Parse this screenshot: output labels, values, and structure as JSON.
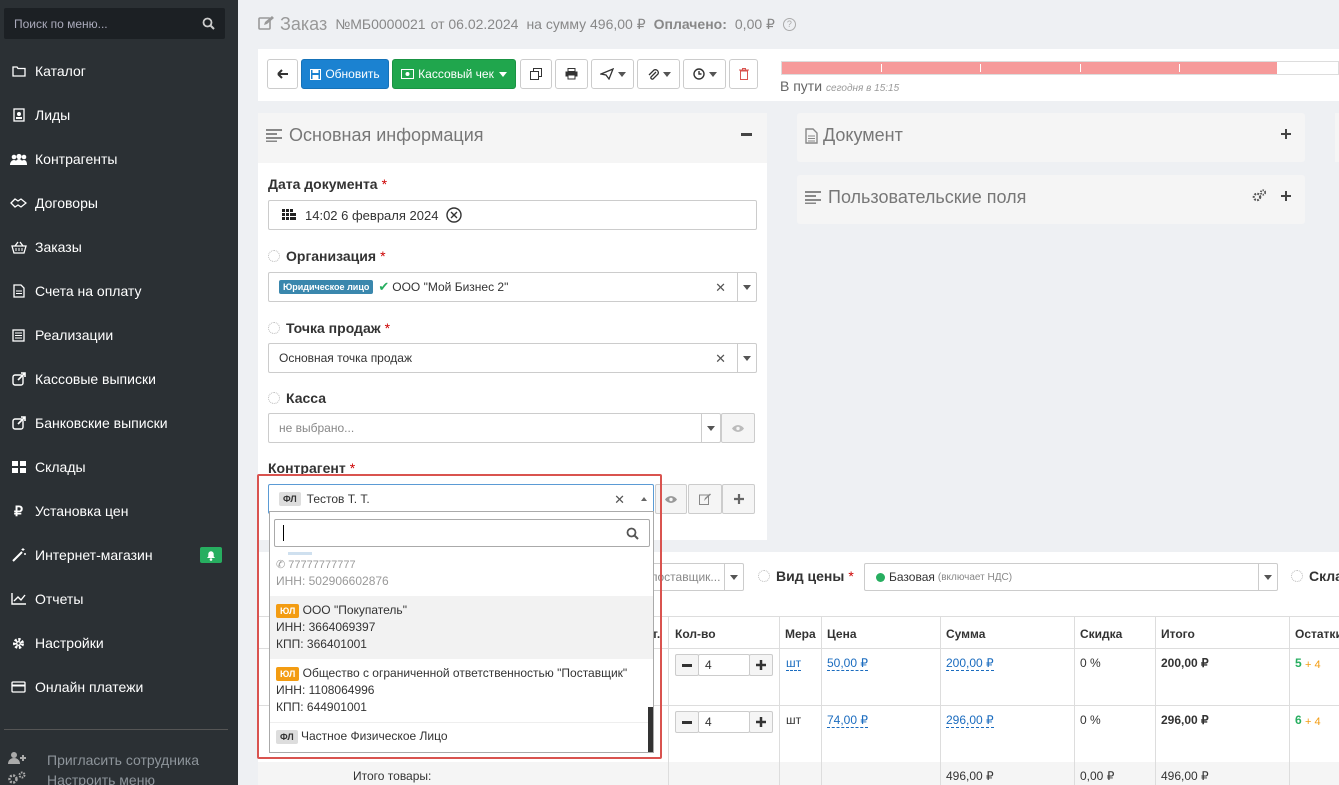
{
  "sidebar": {
    "search_placeholder": "Поиск по меню...",
    "items": [
      {
        "label": "Каталог",
        "icon": "folder-icon"
      },
      {
        "label": "Лиды",
        "icon": "contact-icon"
      },
      {
        "label": "Контрагенты",
        "icon": "users-icon"
      },
      {
        "label": "Договоры",
        "icon": "handshake-icon"
      },
      {
        "label": "Заказы",
        "icon": "basket-icon"
      },
      {
        "label": "Счета на оплату",
        "icon": "file-icon"
      },
      {
        "label": "Реализации",
        "icon": "list-icon"
      },
      {
        "label": "Кассовые выписки",
        "icon": "external-icon"
      },
      {
        "label": "Банковские выписки",
        "icon": "external-icon"
      },
      {
        "label": "Склады",
        "icon": "grid-icon"
      },
      {
        "label": "Установка цен",
        "icon": "ruble-icon"
      },
      {
        "label": "Интернет-магазин",
        "icon": "magic-icon"
      },
      {
        "label": "Отчеты",
        "icon": "chart-icon"
      },
      {
        "label": "Настройки",
        "icon": "gear-icon"
      },
      {
        "label": "Онлайн платежи",
        "icon": "card-icon"
      }
    ],
    "footer": [
      "Пригласить сотрудника",
      "Настроить меню"
    ]
  },
  "header": {
    "title": "Заказ",
    "number": "№МБ0000021",
    "date_text": "от 06.02.2024",
    "sum_text": "на сумму 496,00 ₽",
    "paid_label": "Оплачено:",
    "paid_value": "0,00 ₽"
  },
  "toolbar": {
    "refresh": "Обновить",
    "receipt": "Кассовый чек"
  },
  "status": {
    "label": "В пути",
    "time": "сегодня в 15:15",
    "progress": 0.89
  },
  "main_info": {
    "title": "Основная информация",
    "date_label": "Дата документа",
    "date_value": "14:02 6 февраля 2024",
    "org_label": "Организация",
    "org_badge": "Юридическое лицо",
    "org_value": "ООО \"Мой Бизнес 2\"",
    "point_label": "Точка продаж",
    "point_value": "Основная точка продаж",
    "kassa_label": "Касса",
    "kassa_placeholder": "не выбрано...",
    "contractor_label": "Контрагент",
    "contractor_badge": "ФЛ",
    "contractor_value": "Тестов Т. Т."
  },
  "doc_panel": {
    "title": "Документ"
  },
  "custom_panel": {
    "title": "Пользовательские поля"
  },
  "price": {
    "supplier_placeholder": "поставщик...",
    "label": "Вид цены",
    "value": "Базовая",
    "note": "(включает НДС)",
    "stock_label": "Скла"
  },
  "table": {
    "headers": {
      "qty": "Кол-во",
      "unit": "Мера",
      "price": "Цена",
      "sum": "Сумма",
      "discount": "Скидка",
      "total": "Итого",
      "stock": "Остатки",
      "hidden": "т."
    },
    "rows": [
      {
        "qty": "4",
        "unit": "шт",
        "price": "50,00 ₽",
        "sum": "200,00 ₽",
        "discount": "0 %",
        "total": "200,00 ₽",
        "stock": "5",
        "stock_extra": "+ 4"
      },
      {
        "qty": "4",
        "unit": "шт",
        "price": "74,00 ₽",
        "sum": "296,00 ₽",
        "discount": "0 %",
        "total": "296,00 ₽",
        "stock": "6",
        "stock_extra": "+ 4"
      }
    ],
    "footer": {
      "label": "Итого товары:",
      "sum": "496,00 ₽",
      "discount": "0,00 ₽",
      "total": "496,00 ₽"
    }
  },
  "dropdown": {
    "partial_phone": "77777777777",
    "partial_inn": "ИНН: 502906602876",
    "options": [
      {
        "badge": "ЮЛ",
        "name": "ООО \"Покупатель\"",
        "inn": "ИНН: 3664069397",
        "kpp": "КПП: 366401001"
      },
      {
        "badge": "ЮЛ",
        "name": "Общество с ограниченной ответственностью \"Поставщик\"",
        "inn": "ИНН: 1108064996",
        "kpp": "КПП: 644901001"
      },
      {
        "badge": "ФЛ",
        "name": "Частное Физическое Лицо"
      }
    ]
  },
  "colors": {
    "sidebar": "#2b3034",
    "blue": "#1b82d1",
    "green": "#20a64d",
    "red": "#d9534f",
    "progress": "#f69a9a"
  }
}
